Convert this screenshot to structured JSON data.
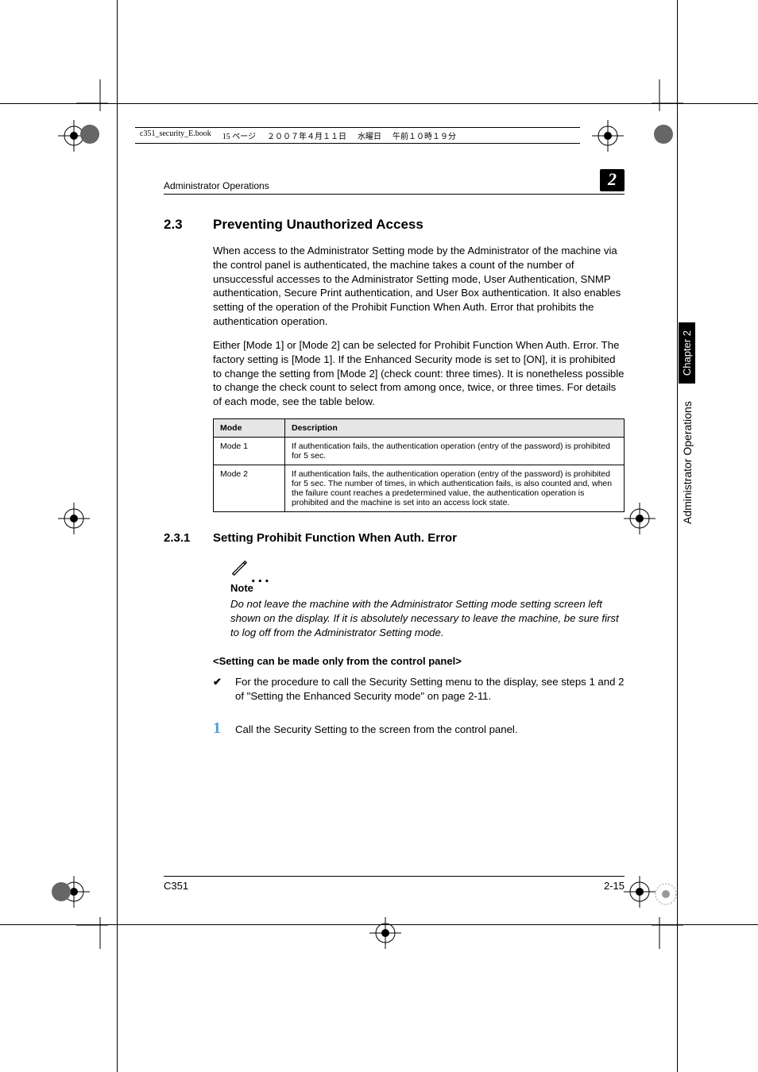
{
  "book_info": {
    "filename": "c351_security_E.book",
    "page_label": "15 ページ",
    "date": "２００７年４月１１日",
    "weekday": "水曜日",
    "time": "午前１０時１９分"
  },
  "header": {
    "title": "Administrator Operations",
    "chapter_badge": "2"
  },
  "side": {
    "section_label": "Administrator Operations",
    "chapter_label": "Chapter 2"
  },
  "section": {
    "number": "2.3",
    "title": "Preventing Unauthorized Access",
    "para1": "When access to the Administrator Setting mode by the Administrator of the machine via the control panel is authenticated, the machine takes a count of the number of unsuccessful accesses to the Administrator Setting mode, User Authentication, SNMP authentication, Secure Print authentication, and User Box authentication. It also enables setting of the operation of the Prohibit Function When Auth. Error that prohibits the authentication operation.",
    "para2": "Either [Mode 1] or [Mode 2] can be selected for Prohibit Function When Auth. Error. The factory setting is [Mode 1]. If the Enhanced Security mode is set to [ON], it is prohibited to change the setting from [Mode 2] (check count: three times). It is nonetheless possible to change the check count to select from among once, twice, or three times. For details of each mode, see the table below."
  },
  "table": {
    "head": {
      "c0": "Mode",
      "c1": "Description"
    },
    "rows": [
      {
        "c0": "Mode 1",
        "c1": "If authentication fails, the authentication operation (entry of the password) is prohibited for 5 sec."
      },
      {
        "c0": "Mode 2",
        "c1": "If authentication fails, the authentication operation (entry of the password) is prohibited for 5 sec. The number of times, in which authentication fails, is also counted and, when the failure count reaches a predetermined value, the authentication operation is prohibited and the machine is set into an access lock state."
      }
    ]
  },
  "subsection": {
    "number": "2.3.1",
    "title": "Setting Prohibit Function When Auth. Error"
  },
  "note": {
    "label": "Note",
    "body": "Do not leave the machine with the Administrator Setting mode setting screen left shown on the display. If it is absolutely necessary to leave the machine, be sure first to log off from the Administrator Setting mode."
  },
  "angle_heading": "<Setting can be made only from the control panel>",
  "check_item": "For the procedure to call the Security Setting menu to the display, see steps 1 and 2 of \"Setting the Enhanced Security mode\" on page 2-11.",
  "step": {
    "num": "1",
    "body": "Call the Security Setting to the screen from the control panel."
  },
  "footer": {
    "left": "C351",
    "right": "2-15"
  }
}
